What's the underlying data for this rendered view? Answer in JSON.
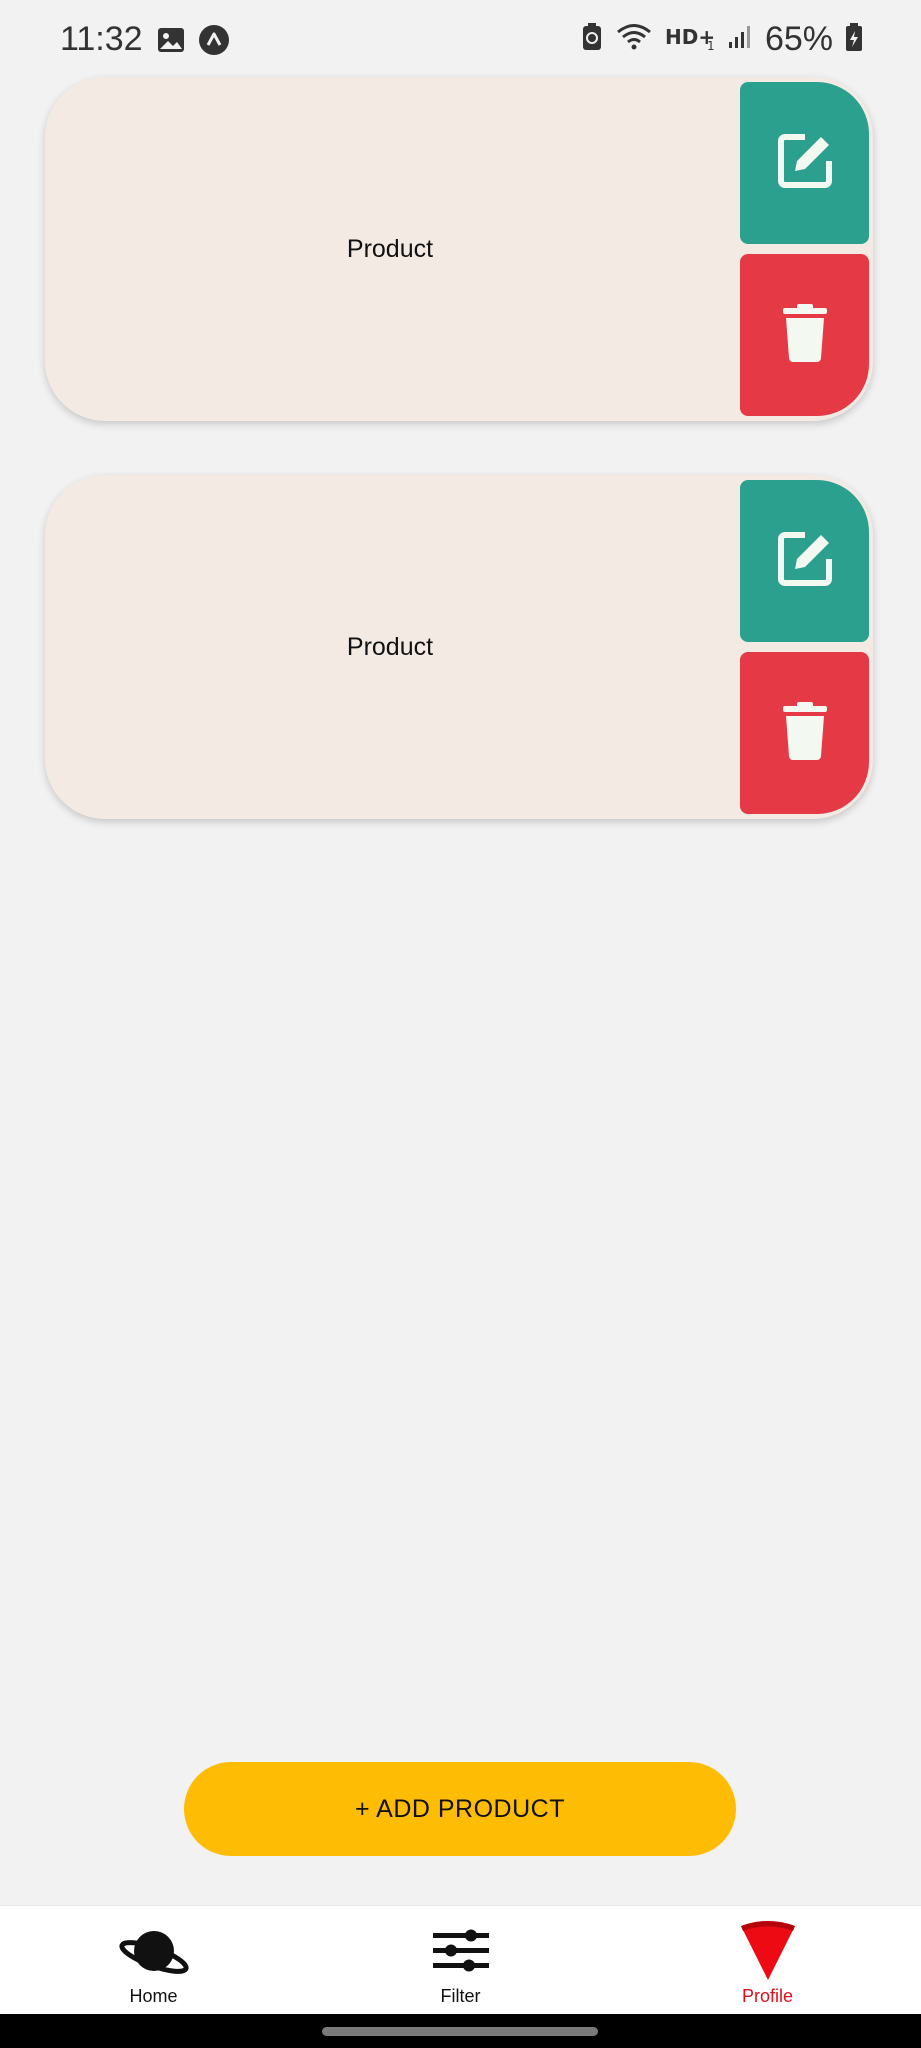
{
  "status_bar": {
    "time": "11:32",
    "battery_percent": "65%",
    "icons": [
      "image-icon",
      "app-notification-icon",
      "battery-saver-icon",
      "wifi-icon",
      "hd-voice-icon",
      "signal-icon",
      "battery-charging-icon"
    ]
  },
  "products": [
    {
      "name": "Product",
      "edit_icon": "edit-icon",
      "delete_icon": "trash-icon"
    },
    {
      "name": "Product",
      "edit_icon": "edit-icon",
      "delete_icon": "trash-icon"
    }
  ],
  "add_button": {
    "label": "+ ADD PRODUCT"
  },
  "bottom_nav": {
    "items": [
      {
        "label": "Home",
        "icon": "planet-icon",
        "active": false
      },
      {
        "label": "Filter",
        "icon": "sliders-icon",
        "active": false
      },
      {
        "label": "Profile",
        "icon": "pizza-icon",
        "active": true
      }
    ]
  },
  "colors": {
    "background": "#f2f2f2",
    "card": "#f3ebe3",
    "edit": "#2ca08e",
    "delete": "#e63946",
    "add_button": "#ffbc04",
    "active_nav": "#e00f1a"
  }
}
